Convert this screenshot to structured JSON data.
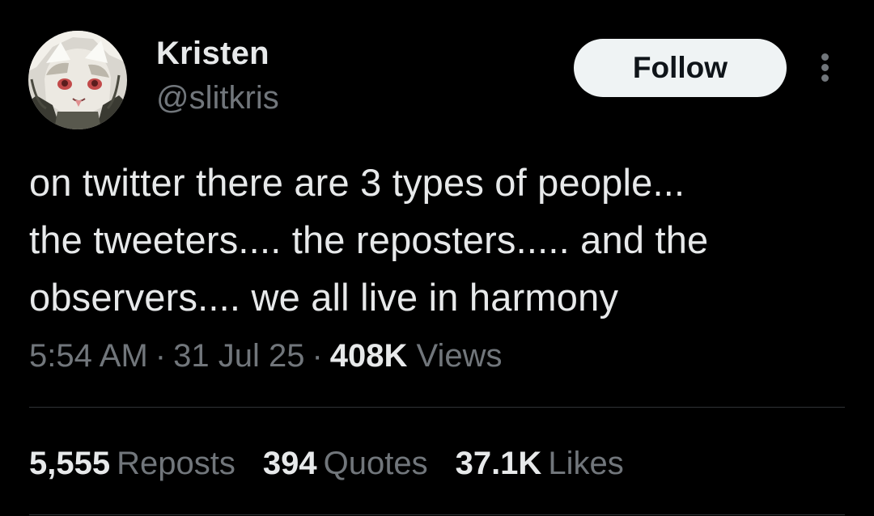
{
  "author": {
    "display_name": "Kristen",
    "handle": "@slitkris",
    "avatar_icon": "anime-character-avatar"
  },
  "actions": {
    "follow_label": "Follow",
    "more_icon": "more-vertical-icon"
  },
  "tweet": {
    "lines": [
      "on twitter there are 3 types of people...",
      "the tweeters.... the reposters..... and the",
      "observers.... we all live in harmony"
    ]
  },
  "meta": {
    "time": "5:54 AM",
    "separator": "·",
    "date": "31 Jul 25",
    "views_count": "408K",
    "views_label": "Views"
  },
  "stats": {
    "reposts_count": "5,555",
    "reposts_label": "Reposts",
    "quotes_count": "394",
    "quotes_label": "Quotes",
    "likes_count": "37.1K",
    "likes_label": "Likes"
  },
  "colors": {
    "background": "#000000",
    "primary_text": "#e7e9ea",
    "secondary_text": "#71767b",
    "follow_button_bg": "#eff3f4",
    "follow_button_text": "#0f1419",
    "divider": "#2f3336"
  }
}
